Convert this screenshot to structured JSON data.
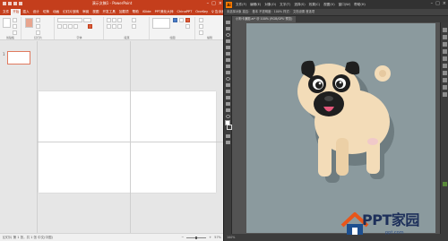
{
  "powerpoint": {
    "title": "演示文稿1 - PowerPoint",
    "tabs": [
      "文件",
      "开始",
      "插入",
      "设计",
      "切换",
      "动画",
      "幻灯片放映",
      "审阅",
      "视图",
      "开发工具",
      "加载项",
      "帮助",
      "iSlide",
      "PPT美化大师",
      "ChinaPPT",
      "OneKey",
      "♀ 告诉我"
    ],
    "active_tab_index": 1,
    "ribbon_groups": [
      "剪贴板",
      "幻灯片",
      "字体",
      "段落",
      "绘图",
      "编辑"
    ],
    "slide_number": "1",
    "status_left": "幻灯片 第 1 张，共 1 张   中文(中国)",
    "zoom_text": "57%"
  },
  "illustrator": {
    "logo": "Ai",
    "menus": [
      "文件(F)",
      "编辑(E)",
      "对象(O)",
      "文字(T)",
      "选择(S)",
      "效果(C)",
      "视图(V)",
      "窗口(W)",
      "帮助(H)"
    ],
    "control_bar_text": "未选择对象    描边：    基本    不透明度：100%   样式：   文档设置   首选项",
    "doc_tab": "小狗卡通图.ai* @ 100% (RGB/GPU 预览)",
    "status_text": "100%"
  },
  "watermark": {
    "text": "PPT家园",
    "sub": "ppt.com"
  },
  "colors": {
    "ppt_accent": "#c43e1c",
    "ai_accent": "#ff7c00",
    "artboard_bg": "#8b9a9e",
    "pug_body": "#f3dcb8",
    "pug_dark": "#1f1f1f"
  }
}
